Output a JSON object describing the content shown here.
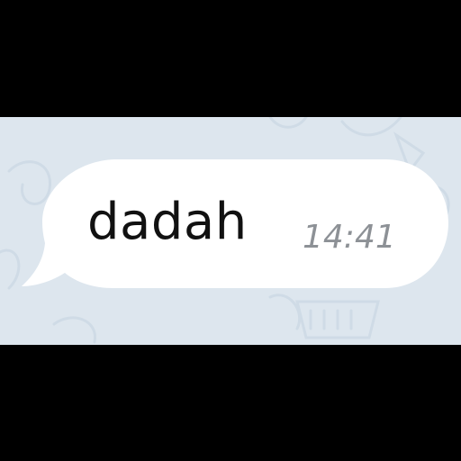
{
  "chat": {
    "wallpaper_color": "#dde6ee",
    "message": {
      "text": "dadah",
      "time": "14:41",
      "bubble_color": "#ffffff",
      "text_color": "#111111",
      "time_color": "#8d9196",
      "direction": "incoming"
    }
  }
}
